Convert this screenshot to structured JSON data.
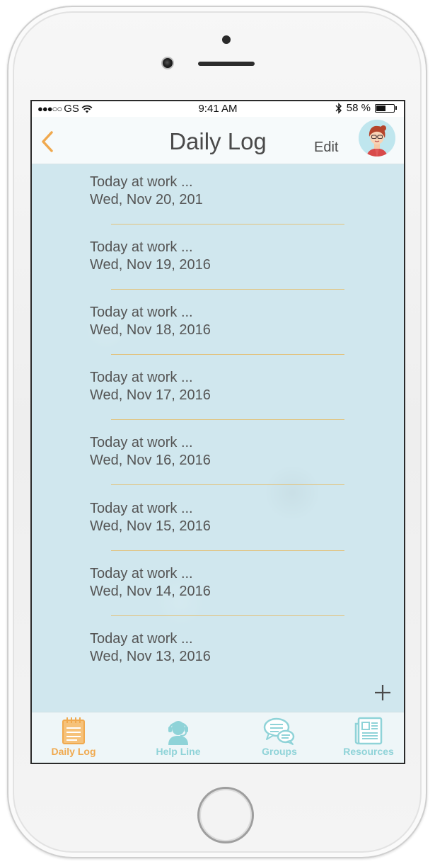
{
  "status_bar": {
    "carrier": "GS",
    "signal_dots": "●●●○○",
    "time": "9:41 AM",
    "battery_percent": "58 %",
    "battery_level": 0.58
  },
  "nav": {
    "title": "Daily Log",
    "edit_label": "Edit"
  },
  "entries": [
    {
      "title": "Today at work ...",
      "date": "Wed, Nov 20, 201"
    },
    {
      "title": "Today at work ...",
      "date": "Wed, Nov 19, 2016"
    },
    {
      "title": "Today at work ...",
      "date": "Wed, Nov 18, 2016"
    },
    {
      "title": "Today at work ...",
      "date": "Wed, Nov 17, 2016"
    },
    {
      "title": "Today at work ...",
      "date": "Wed, Nov 16, 2016"
    },
    {
      "title": "Today at work ...",
      "date": "Wed, Nov 15, 2016"
    },
    {
      "title": "Today at work ...",
      "date": "Wed, Nov 14, 2016"
    },
    {
      "title": "Today at work ...",
      "date": "Wed, Nov 13, 2016"
    }
  ],
  "tabs": [
    {
      "label": "Daily Log",
      "icon": "notepad-icon",
      "active": true
    },
    {
      "label": "Help Line",
      "icon": "headset-agent-icon",
      "active": false
    },
    {
      "label": "Groups",
      "icon": "chat-bubbles-icon",
      "active": false
    },
    {
      "label": "Resources",
      "icon": "newspaper-icon",
      "active": false
    }
  ],
  "colors": {
    "accent": "#f0a94e",
    "tab_inactive": "#8fd3d8",
    "content_bg": "#d0e7ee",
    "divider": "#e2c27b",
    "text": "#555555"
  }
}
